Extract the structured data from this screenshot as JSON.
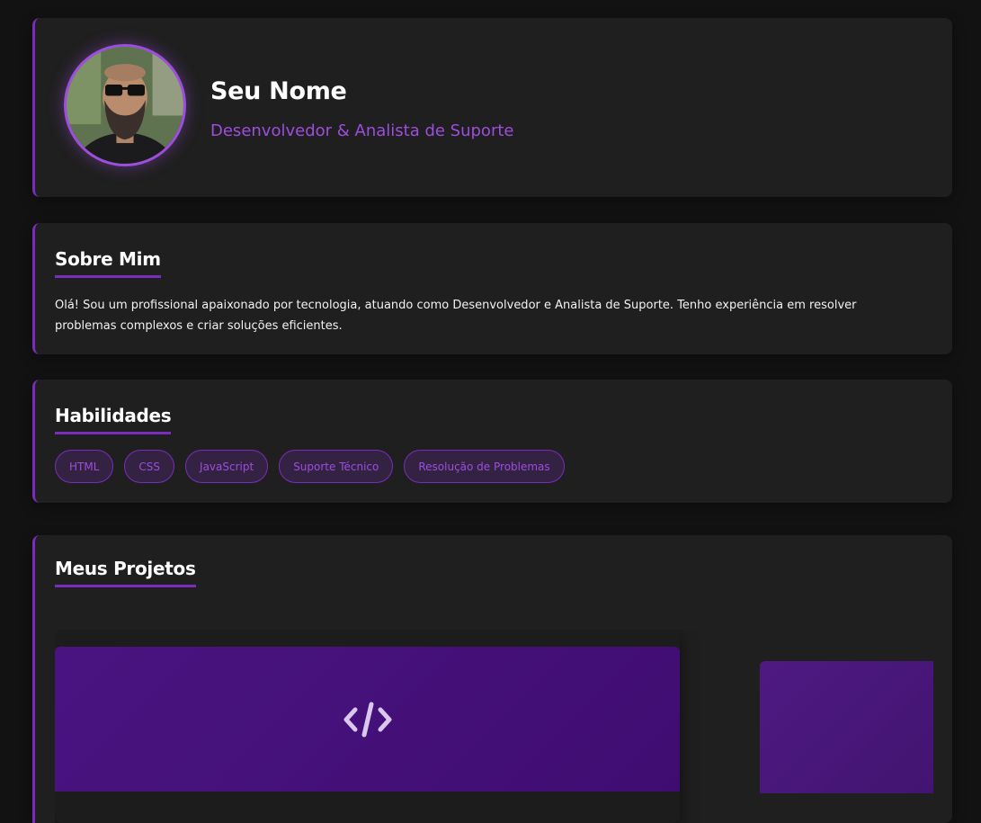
{
  "profile": {
    "name": "Seu Nome",
    "role": "Desenvolvedor & Analista de Suporte"
  },
  "about": {
    "title": "Sobre Mim",
    "text": "Olá! Sou um profissional apaixonado por tecnologia, atuando como Desenvolvedor e Analista de Suporte. Tenho experiência em resolver problemas complexos e criar soluções eficientes."
  },
  "skills": {
    "title": "Habilidades",
    "items": [
      "HTML",
      "CSS",
      "JavaScript",
      "Suporte Técnico",
      "Resolução de Problemas"
    ]
  },
  "projects": {
    "title": "Meus Projetos",
    "icons": [
      "code-icon"
    ]
  },
  "colors": {
    "accent": "#7b2cbf",
    "accent_text": "#9d4edd",
    "background": "#121212",
    "card": "#1f1f1f"
  }
}
